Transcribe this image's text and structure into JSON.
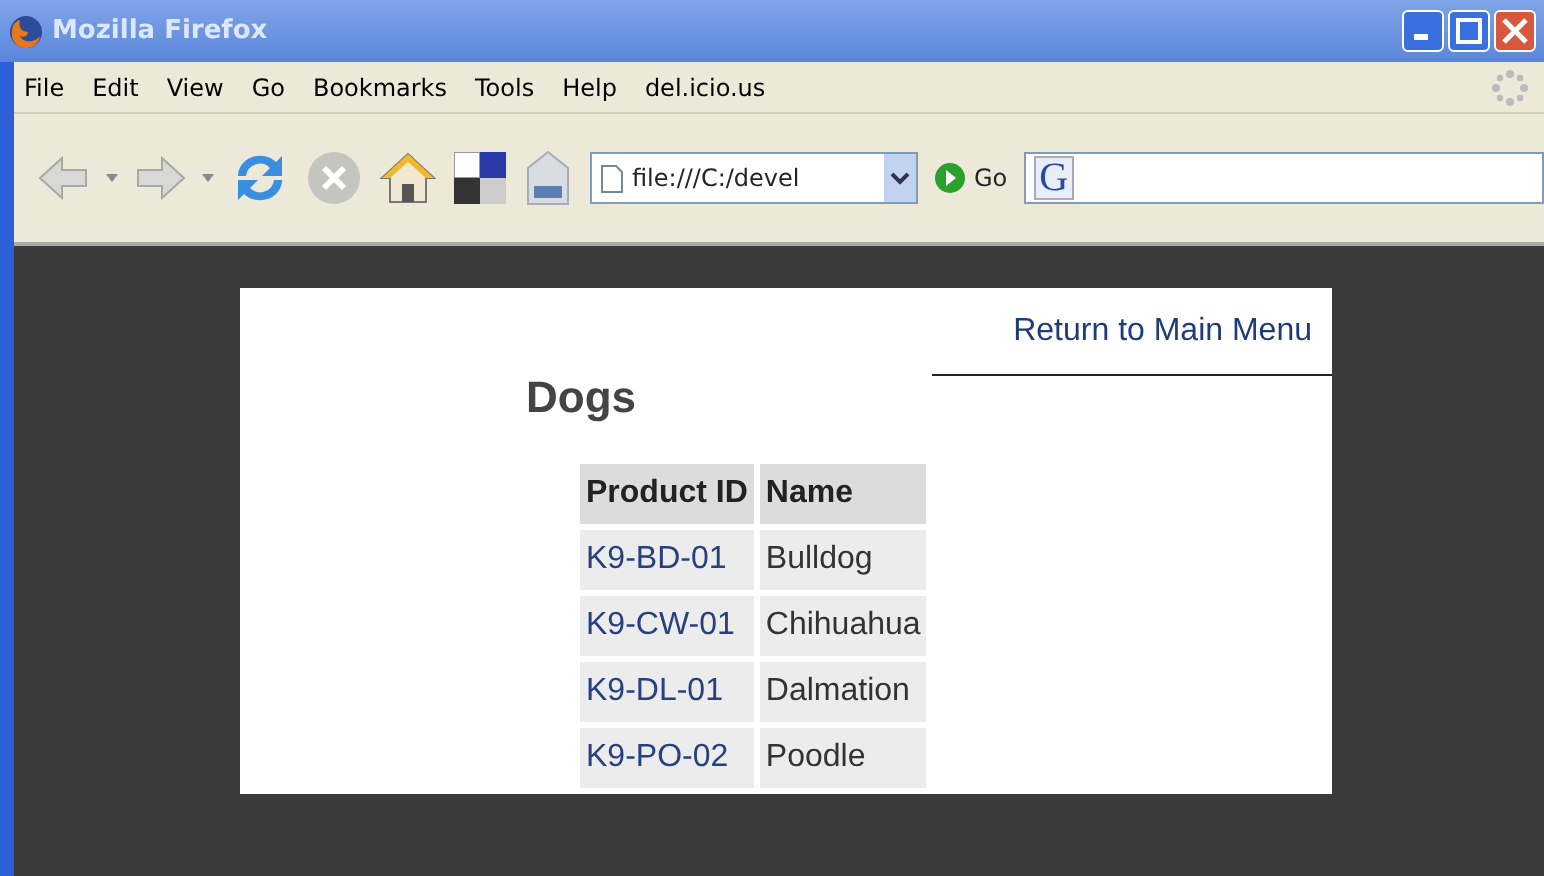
{
  "window": {
    "title": "Mozilla Firefox"
  },
  "menu": [
    "File",
    "Edit",
    "View",
    "Go",
    "Bookmarks",
    "Tools",
    "Help",
    "del.icio.us"
  ],
  "address": {
    "value": "file:///C:/devel"
  },
  "go_label": "Go",
  "search_engine": "G",
  "page": {
    "link": "Return to Main Menu",
    "heading": "Dogs",
    "table": {
      "columns": [
        "Product ID",
        "Name"
      ],
      "rows": [
        [
          "K9-BD-01",
          "Bulldog"
        ],
        [
          "K9-CW-01",
          "Chihuahua"
        ],
        [
          "K9-DL-01",
          "Dalmation"
        ],
        [
          "K9-PO-02",
          "Poodle"
        ]
      ]
    }
  }
}
